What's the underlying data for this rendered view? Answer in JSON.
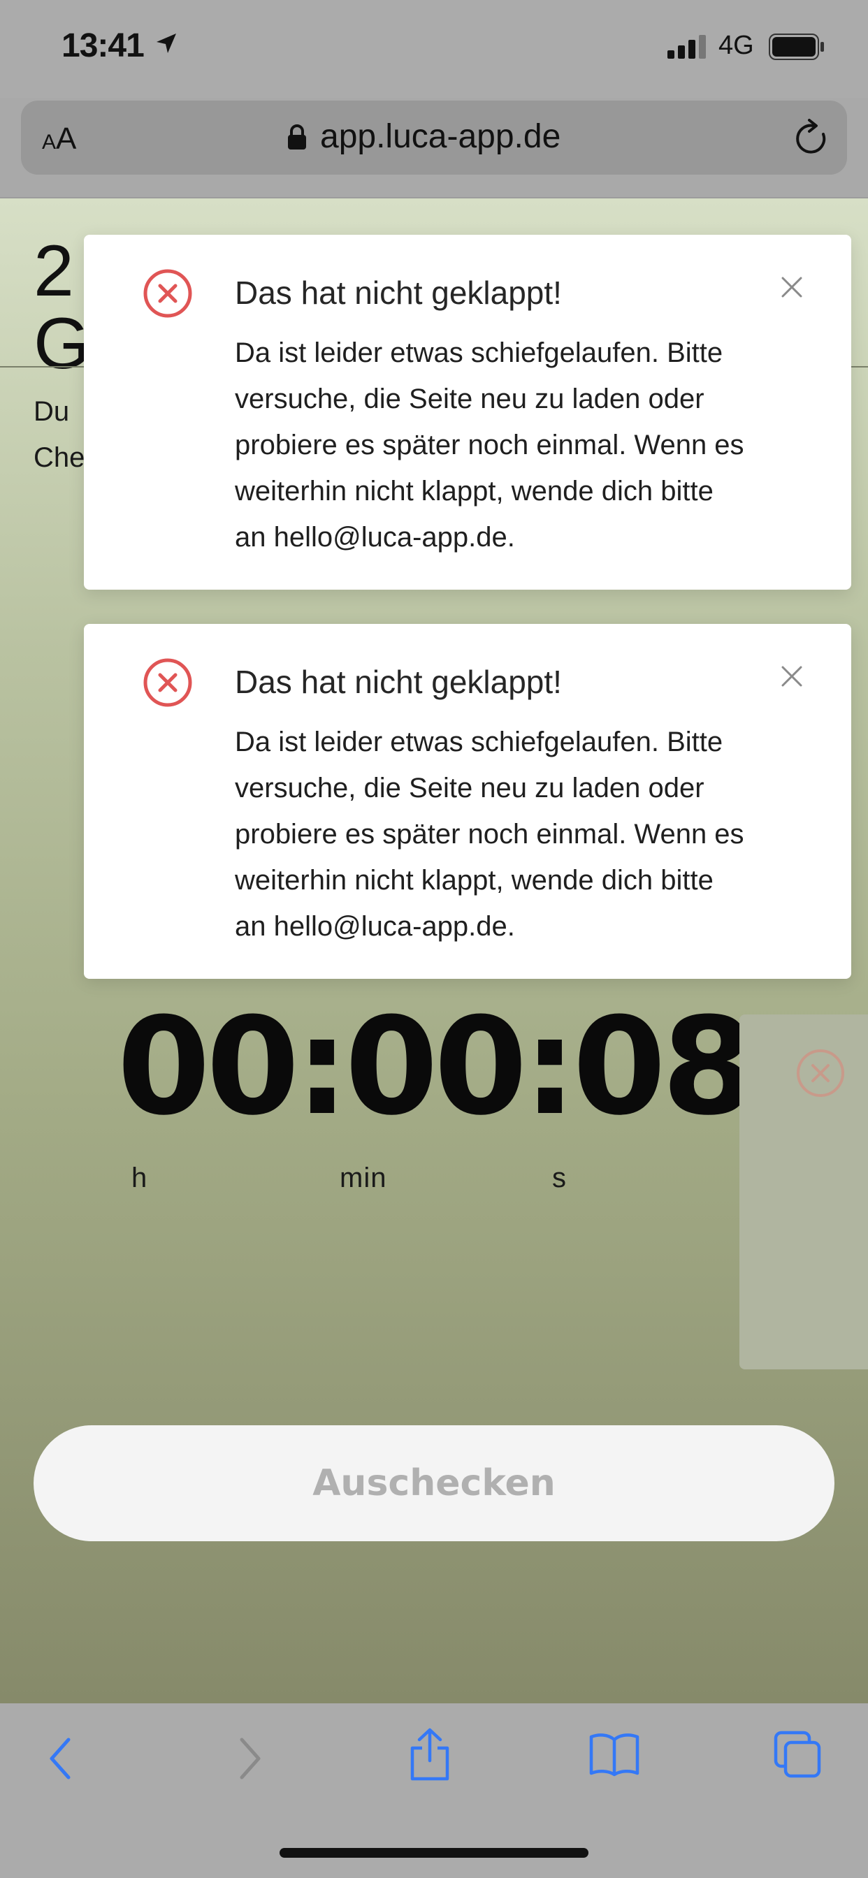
{
  "status_bar": {
    "time": "13:41",
    "network": "4G",
    "location_icon": "location-arrow-icon",
    "signal_icon": "cellular-signal-icon",
    "battery_icon": "battery-icon"
  },
  "browser": {
    "aa_small": "A",
    "aa_big": "A",
    "url": "app.luca-app.de",
    "lock_icon": "lock-icon",
    "reload_icon": "reload-icon"
  },
  "page": {
    "hidden_title_line1": "2",
    "hidden_title_line2": "G",
    "hidden_sub_line1": "Du",
    "hidden_sub_line2": "Che",
    "timer": "00:00:08",
    "units": {
      "hours": "h",
      "minutes": "min",
      "seconds": "s"
    },
    "checkout_label": "Auschecken"
  },
  "toasts": [
    {
      "title": "Das hat nicht geklappt!",
      "lines": [
        "Da ist leider etwas schiefgelaufen. Bitte",
        "versuche, die Seite neu zu laden oder",
        "probiere es später noch einmal. Wenn es",
        "weiterhin nicht klappt, wende dich bitte",
        "an hello@luca-app.de."
      ]
    },
    {
      "title": "Das hat nicht geklappt!",
      "lines": [
        "Da ist leider etwas schiefgelaufen. Bitte",
        "versuche, die Seite neu zu laden oder",
        "probiere es später noch einmal. Wenn es",
        "weiterhin nicht klappt, wende dich bitte",
        "an hello@luca-app.de."
      ]
    }
  ],
  "toolbar": {
    "icons": [
      "back-icon",
      "forward-icon",
      "share-icon",
      "bookmarks-icon",
      "tabs-icon"
    ]
  },
  "colors": {
    "error_red": "#e05555",
    "link_blue": "#3478f6",
    "disabled_gray": "#b0b0b0"
  }
}
